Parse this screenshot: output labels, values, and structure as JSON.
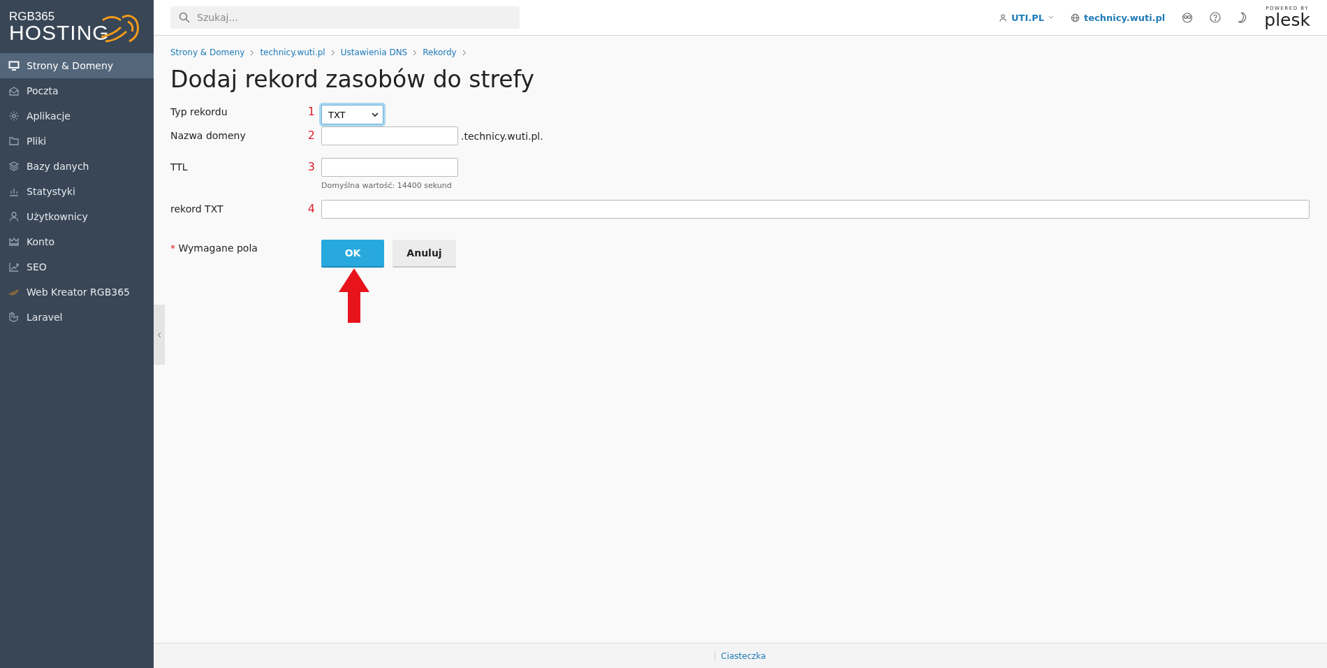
{
  "logo": {
    "line_1": "RGB365",
    "line_2": "HOSTING"
  },
  "sidebar": {
    "items": [
      {
        "label": "Strony & Domeny",
        "selected": true
      },
      {
        "label": "Poczta",
        "selected": false
      },
      {
        "label": "Aplikacje",
        "selected": false
      },
      {
        "label": "Pliki",
        "selected": false
      },
      {
        "label": "Bazy danych",
        "selected": false
      },
      {
        "label": "Statystyki",
        "selected": false
      },
      {
        "label": "Użytkownicy",
        "selected": false
      },
      {
        "label": "Konto",
        "selected": false
      },
      {
        "label": "SEO",
        "selected": false
      },
      {
        "label": "Web Kreator RGB365",
        "selected": false
      },
      {
        "label": "Laravel",
        "selected": false
      }
    ]
  },
  "header": {
    "search": {
      "placeholder": "Szukaj..."
    },
    "user": "UTI.PL",
    "domain": "technicy.wuti.pl",
    "powered_by": "POWERED BY",
    "brand": "plesk"
  },
  "breadcrumbs": [
    "Strony & Domeny",
    "technicy.wuti.pl",
    "Ustawienia DNS",
    "Rekordy"
  ],
  "title": "Dodaj rekord zasobów do strefy",
  "form": {
    "fields": [
      {
        "kind": "select",
        "label": "Typ rekordu",
        "marker": "1",
        "value": "TXT"
      },
      {
        "kind": "short",
        "label": "Nazwa domeny",
        "marker": "2",
        "suffix": ".technicy.wuti.pl."
      },
      {
        "kind": "short",
        "label": "TTL",
        "marker": "3",
        "hint": "Domyślna wartość: 14400 sekund"
      },
      {
        "kind": "wide",
        "label": "rekord TXT",
        "marker": "4"
      }
    ],
    "required_mark": "*",
    "required_note": "Wymagane pola",
    "buttons": [
      {
        "label": "OK",
        "kind": "primary"
      },
      {
        "label": "Anuluj",
        "kind": "secondary"
      }
    ]
  },
  "footer": {
    "link": "Ciasteczka"
  }
}
